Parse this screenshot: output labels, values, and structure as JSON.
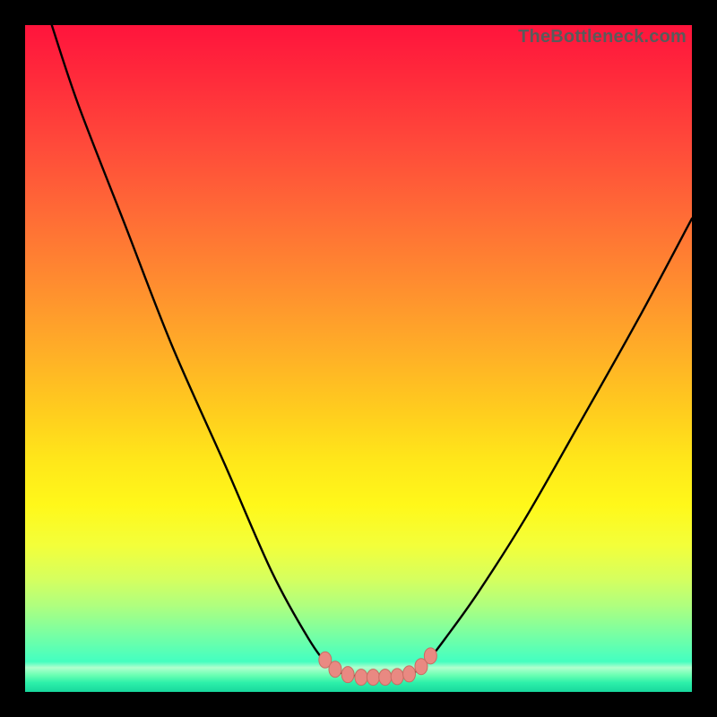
{
  "watermark": "TheBottleneck.com",
  "colors": {
    "frame": "#000000",
    "curve": "#000000",
    "dot_fill": "#e98982",
    "dot_stroke": "#c76d63"
  },
  "chart_data": {
    "type": "line",
    "title": "",
    "xlabel": "",
    "ylabel": "",
    "xlim": [
      0,
      100
    ],
    "ylim": [
      0,
      100
    ],
    "grid": false,
    "series": [
      {
        "name": "bottleneck-curve",
        "x": [
          4,
          8,
          15,
          22,
          30,
          37,
          42.5,
          45.5,
          47.5,
          49.5,
          51,
          53,
          55,
          57,
          58.5,
          60.5,
          63,
          68,
          75,
          83,
          92,
          100
        ],
        "y": [
          100,
          88,
          70,
          52,
          34,
          18,
          8,
          4,
          2.8,
          2.4,
          2.2,
          2.2,
          2.2,
          2.4,
          3,
          4.8,
          8,
          15,
          26,
          40,
          56,
          71
        ]
      }
    ],
    "markers": [
      {
        "x": 45.0,
        "y": 4.8
      },
      {
        "x": 46.5,
        "y": 3.4
      },
      {
        "x": 48.4,
        "y": 2.6
      },
      {
        "x": 50.4,
        "y": 2.2
      },
      {
        "x": 52.2,
        "y": 2.2
      },
      {
        "x": 54.0,
        "y": 2.2
      },
      {
        "x": 55.8,
        "y": 2.3
      },
      {
        "x": 57.6,
        "y": 2.7
      },
      {
        "x": 59.4,
        "y": 3.8
      },
      {
        "x": 60.8,
        "y": 5.4
      }
    ]
  }
}
